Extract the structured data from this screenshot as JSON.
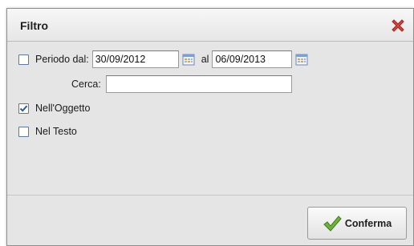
{
  "dialog": {
    "title": "Filtro",
    "close_icon": "close-x-icon"
  },
  "filters": {
    "periodo": {
      "label": "Periodo dal:",
      "checked": false,
      "from_value": "30/09/2012",
      "to_label": "al",
      "to_value": "06/09/2013"
    },
    "cerca": {
      "label": "Cerca:",
      "value": ""
    },
    "nell_oggetto": {
      "label": "Nell'Oggetto",
      "checked": true
    },
    "nel_testo": {
      "label": "Nel Testo",
      "checked": false
    }
  },
  "actions": {
    "confirm_label": "Conferma",
    "confirm_icon": "checkmark-icon"
  },
  "colors": {
    "close_icon": "#d9433a",
    "check": "#2d5aa6",
    "confirm_icon": "#6fb33a"
  }
}
